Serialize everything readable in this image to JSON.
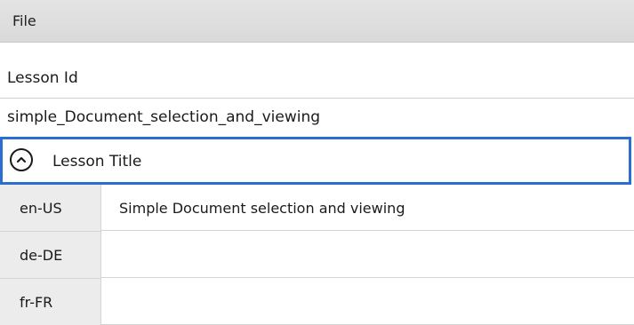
{
  "menu": {
    "file_label": "File"
  },
  "lesson": {
    "id_label": "Lesson Id",
    "id_value": "simple_Document_selection_and_viewing"
  },
  "title_section": {
    "label": "Lesson Title"
  },
  "translations": [
    {
      "lang": "en-US",
      "value": "Simple Document selection and viewing"
    },
    {
      "lang": "de-DE",
      "value": ""
    },
    {
      "lang": "fr-FR",
      "value": ""
    }
  ],
  "colors": {
    "focus_border": "#2a6fd0",
    "lang_cell_bg": "#ececec",
    "menubar_bg": "#dcdcdc"
  },
  "icons": {
    "collapse": "chevron-up-circle-icon"
  }
}
